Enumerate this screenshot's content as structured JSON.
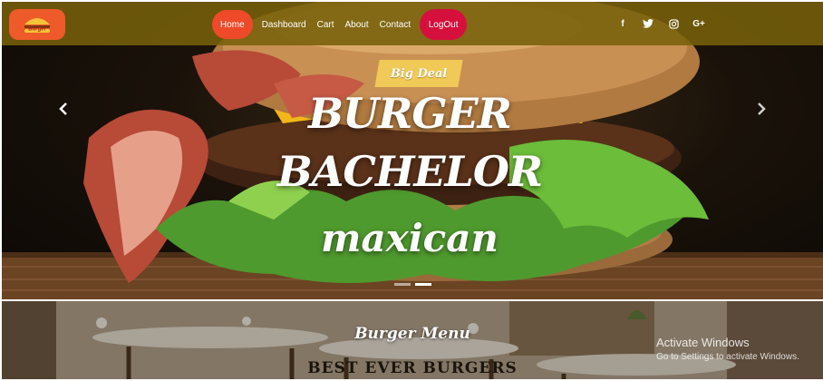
{
  "brand": {
    "logo_text": "Burger"
  },
  "nav": {
    "home": "Home",
    "dashboard": "Dashboard",
    "cart": "Cart",
    "about": "About",
    "contact": "Contact",
    "logout": "LogOut"
  },
  "social": {
    "facebook": "f",
    "twitter": "twitter-icon",
    "instagram": "instagram-icon",
    "google": "G+"
  },
  "hero": {
    "badge": "Big Deal",
    "title_line1": "BURGER",
    "title_line2": "BACHELOR",
    "title_line3": "maxican"
  },
  "menu": {
    "heading": "Burger Menu",
    "subheading": "BEST EVER BURGERS"
  },
  "windows_notice": {
    "title": "Activate Windows",
    "subtitle": "Go to Settings to activate Windows."
  },
  "colors": {
    "nav_bg": "#76600a",
    "home_active": "#ee4a2a",
    "logout": "#d6103c",
    "badge": "#f1c957",
    "logo_bg": "#ee5a2a"
  }
}
